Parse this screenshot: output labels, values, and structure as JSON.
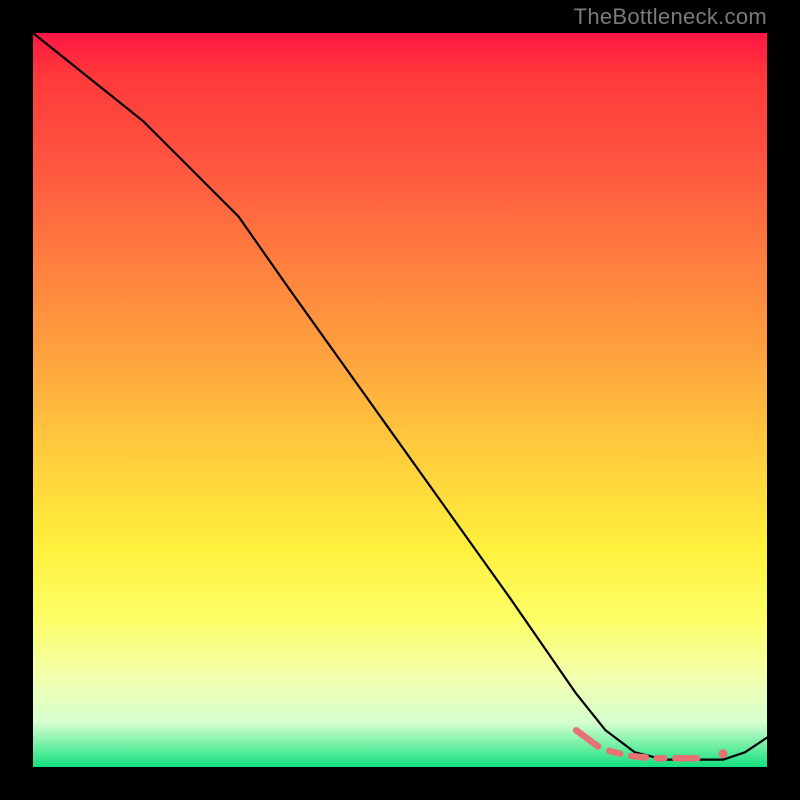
{
  "watermark": "TheBottleneck.com",
  "chart_data": {
    "type": "line",
    "title": "",
    "xlabel": "",
    "ylabel": "",
    "xlim": [
      0,
      100
    ],
    "ylim": [
      0,
      100
    ],
    "grid": false,
    "legend": false,
    "background_gradient": {
      "direction": "vertical",
      "stops": [
        {
          "pos": 0,
          "color": "#ff1744"
        },
        {
          "pos": 6,
          "color": "#ff3a3a"
        },
        {
          "pos": 17,
          "color": "#ff5340"
        },
        {
          "pos": 30,
          "color": "#ff7b3f"
        },
        {
          "pos": 44,
          "color": "#ffa23e"
        },
        {
          "pos": 56,
          "color": "#ffc93d"
        },
        {
          "pos": 70,
          "color": "#fff03c"
        },
        {
          "pos": 80,
          "color": "#fdff68"
        },
        {
          "pos": 88,
          "color": "#f2ffb0"
        },
        {
          "pos": 94,
          "color": "#d4ffcf"
        },
        {
          "pos": 100,
          "color": "#13e07e"
        }
      ]
    },
    "series": [
      {
        "name": "main-curve",
        "type": "line",
        "x": [
          0,
          5,
          10,
          15,
          20,
          24,
          28,
          35,
          45,
          55,
          65,
          74,
          78,
          82,
          86,
          90,
          94,
          97,
          100
        ],
        "y": [
          100,
          96,
          92,
          88,
          83,
          79,
          75,
          65,
          51,
          37,
          23,
          10,
          5,
          2,
          1,
          1,
          1,
          2,
          4
        ]
      },
      {
        "name": "highlight-dashes",
        "type": "segments",
        "color": "#e57373",
        "segments": [
          {
            "x0": 74.0,
            "y0": 5.0,
            "x1": 77.0,
            "y1": 2.8
          },
          {
            "x0": 78.5,
            "y0": 2.2,
            "x1": 80.0,
            "y1": 1.8
          },
          {
            "x0": 81.5,
            "y0": 1.5,
            "x1": 83.5,
            "y1": 1.3
          },
          {
            "x0": 85.0,
            "y0": 1.2,
            "x1": 86.0,
            "y1": 1.2
          },
          {
            "x0": 87.5,
            "y0": 1.2,
            "x1": 90.5,
            "y1": 1.2
          }
        ],
        "end_dot": {
          "x": 94.0,
          "y": 1.8,
          "r": 4.5
        }
      }
    ]
  }
}
